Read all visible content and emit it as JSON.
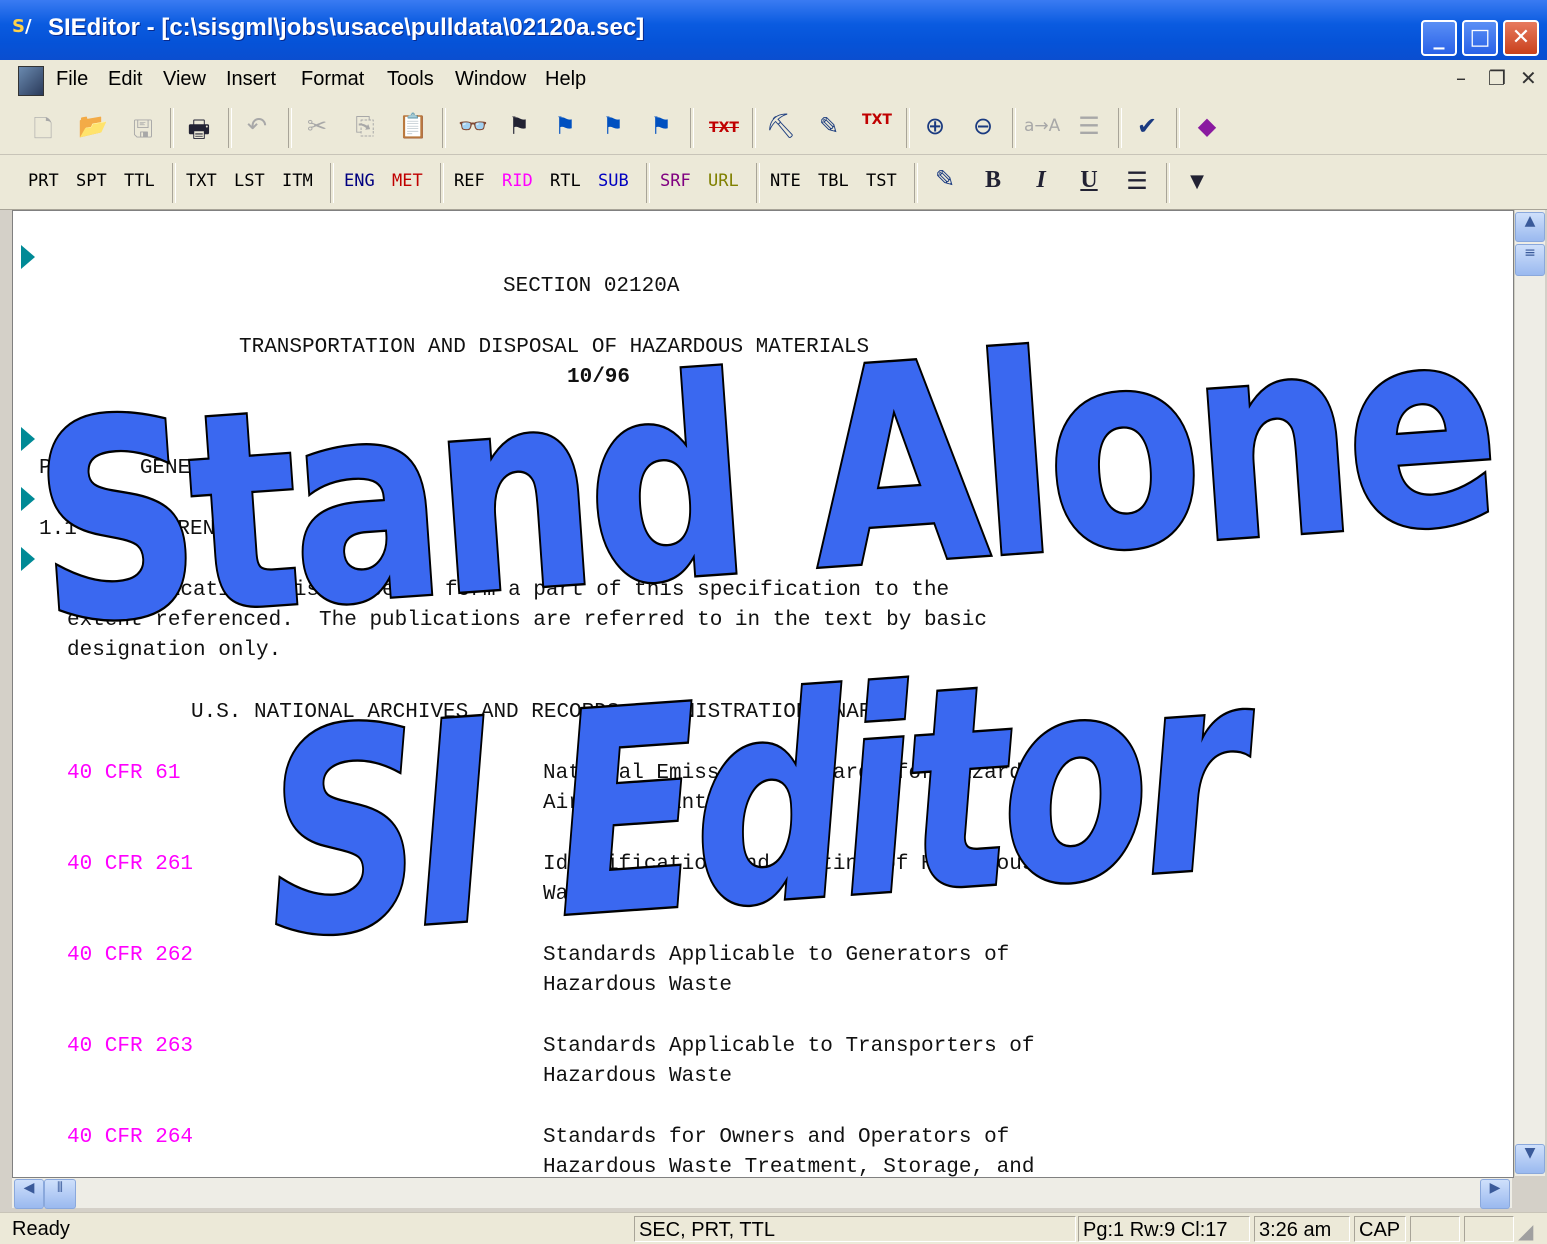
{
  "window": {
    "title": "SIEditor - [c:\\sisgml\\jobs\\usace\\pulldata\\02120a.sec]"
  },
  "menu": [
    "File",
    "Edit",
    "View",
    "Insert",
    "Format",
    "Tools",
    "Window",
    "Help"
  ],
  "tag_toolbar": {
    "tags": [
      {
        "label": "PRT",
        "color": "#000000"
      },
      {
        "label": "SPT",
        "color": "#000000"
      },
      {
        "label": "TTL",
        "color": "#000000"
      },
      {
        "label": "TXT",
        "color": "#000000"
      },
      {
        "label": "LST",
        "color": "#000000"
      },
      {
        "label": "ITM",
        "color": "#000000"
      },
      {
        "label": "ENG",
        "color": "#000080"
      },
      {
        "label": "MET",
        "color": "#c00000"
      },
      {
        "label": "REF",
        "color": "#000000"
      },
      {
        "label": "RID",
        "color": "#ff00ff"
      },
      {
        "label": "RTL",
        "color": "#000000"
      },
      {
        "label": "SUB",
        "color": "#0000c0"
      },
      {
        "label": "SRF",
        "color": "#800080"
      },
      {
        "label": "URL",
        "color": "#808000"
      },
      {
        "label": "NTE",
        "color": "#000000"
      },
      {
        "label": "TBL",
        "color": "#000000"
      },
      {
        "label": "TST",
        "color": "#000000"
      }
    ],
    "format_buttons": {
      "bold": "B",
      "italic": "I",
      "underline": "U"
    }
  },
  "document": {
    "section_title": "SECTION 02120A",
    "title": "TRANSPORTATION AND DISPOSAL OF HAZARDOUS MATERIALS",
    "date": "10/96",
    "part": "PART    GENERAL",
    "para_num": "1.1",
    "para_heading": "REFERENCES",
    "intro_lines": [
      "The publications listed below form a part of this specification to the",
      "extent referenced.  The publications are referred to in the text by basic",
      "designation only."
    ],
    "org": "U.S. NATIONAL ARCHIVES AND RECORDS ADMINISTRATION (NARA)",
    "references": [
      {
        "id": "40 CFR 61",
        "lines": [
          "National Emission Standards for Hazardous",
          "Air Pollutants"
        ]
      },
      {
        "id": "40 CFR 261",
        "lines": [
          "Identification and Listing of Hazardous",
          "Waste"
        ]
      },
      {
        "id": "40 CFR 262",
        "lines": [
          "Standards Applicable to Generators of",
          "Hazardous Waste"
        ]
      },
      {
        "id": "40 CFR 263",
        "lines": [
          "Standards Applicable to Transporters of",
          "Hazardous Waste"
        ]
      },
      {
        "id": "40 CFR 264",
        "lines": [
          "Standards for Owners and Operators of",
          "Hazardous Waste Treatment, Storage, and"
        ]
      }
    ]
  },
  "status": {
    "message": "Ready",
    "context": "SEC, PRT, TTL",
    "position": "Pg:1 Rw:9 Cl:17",
    "time": "3:26 am",
    "caps": "CAP"
  },
  "overlay": {
    "line1": "Stand Alone",
    "line2": "SI Editor",
    "fill_color": "#3a68f0"
  }
}
